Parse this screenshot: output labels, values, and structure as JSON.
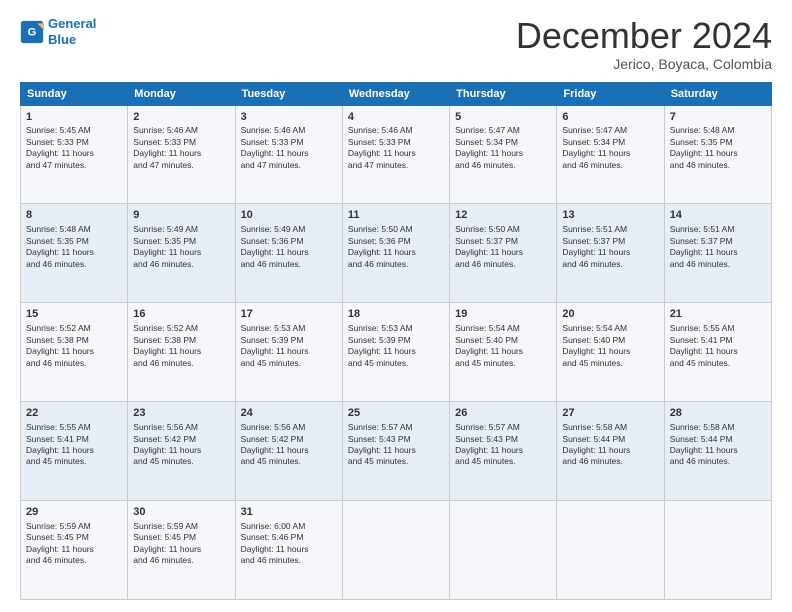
{
  "logo": {
    "line1": "General",
    "line2": "Blue"
  },
  "title": "December 2024",
  "subtitle": "Jerico, Boyaca, Colombia",
  "weekdays": [
    "Sunday",
    "Monday",
    "Tuesday",
    "Wednesday",
    "Thursday",
    "Friday",
    "Saturday"
  ],
  "weeks": [
    [
      {
        "day": 1,
        "lines": [
          "Sunrise: 5:45 AM",
          "Sunset: 5:33 PM",
          "Daylight: 11 hours",
          "and 47 minutes."
        ]
      },
      {
        "day": 2,
        "lines": [
          "Sunrise: 5:46 AM",
          "Sunset: 5:33 PM",
          "Daylight: 11 hours",
          "and 47 minutes."
        ]
      },
      {
        "day": 3,
        "lines": [
          "Sunrise: 5:46 AM",
          "Sunset: 5:33 PM",
          "Daylight: 11 hours",
          "and 47 minutes."
        ]
      },
      {
        "day": 4,
        "lines": [
          "Sunrise: 5:46 AM",
          "Sunset: 5:33 PM",
          "Daylight: 11 hours",
          "and 47 minutes."
        ]
      },
      {
        "day": 5,
        "lines": [
          "Sunrise: 5:47 AM",
          "Sunset: 5:34 PM",
          "Daylight: 11 hours",
          "and 46 minutes."
        ]
      },
      {
        "day": 6,
        "lines": [
          "Sunrise: 5:47 AM",
          "Sunset: 5:34 PM",
          "Daylight: 11 hours",
          "and 46 minutes."
        ]
      },
      {
        "day": 7,
        "lines": [
          "Sunrise: 5:48 AM",
          "Sunset: 5:35 PM",
          "Daylight: 11 hours",
          "and 46 minutes."
        ]
      }
    ],
    [
      {
        "day": 8,
        "lines": [
          "Sunrise: 5:48 AM",
          "Sunset: 5:35 PM",
          "Daylight: 11 hours",
          "and 46 minutes."
        ]
      },
      {
        "day": 9,
        "lines": [
          "Sunrise: 5:49 AM",
          "Sunset: 5:35 PM",
          "Daylight: 11 hours",
          "and 46 minutes."
        ]
      },
      {
        "day": 10,
        "lines": [
          "Sunrise: 5:49 AM",
          "Sunset: 5:36 PM",
          "Daylight: 11 hours",
          "and 46 minutes."
        ]
      },
      {
        "day": 11,
        "lines": [
          "Sunrise: 5:50 AM",
          "Sunset: 5:36 PM",
          "Daylight: 11 hours",
          "and 46 minutes."
        ]
      },
      {
        "day": 12,
        "lines": [
          "Sunrise: 5:50 AM",
          "Sunset: 5:37 PM",
          "Daylight: 11 hours",
          "and 46 minutes."
        ]
      },
      {
        "day": 13,
        "lines": [
          "Sunrise: 5:51 AM",
          "Sunset: 5:37 PM",
          "Daylight: 11 hours",
          "and 46 minutes."
        ]
      },
      {
        "day": 14,
        "lines": [
          "Sunrise: 5:51 AM",
          "Sunset: 5:37 PM",
          "Daylight: 11 hours",
          "and 46 minutes."
        ]
      }
    ],
    [
      {
        "day": 15,
        "lines": [
          "Sunrise: 5:52 AM",
          "Sunset: 5:38 PM",
          "Daylight: 11 hours",
          "and 46 minutes."
        ]
      },
      {
        "day": 16,
        "lines": [
          "Sunrise: 5:52 AM",
          "Sunset: 5:38 PM",
          "Daylight: 11 hours",
          "and 46 minutes."
        ]
      },
      {
        "day": 17,
        "lines": [
          "Sunrise: 5:53 AM",
          "Sunset: 5:39 PM",
          "Daylight: 11 hours",
          "and 45 minutes."
        ]
      },
      {
        "day": 18,
        "lines": [
          "Sunrise: 5:53 AM",
          "Sunset: 5:39 PM",
          "Daylight: 11 hours",
          "and 45 minutes."
        ]
      },
      {
        "day": 19,
        "lines": [
          "Sunrise: 5:54 AM",
          "Sunset: 5:40 PM",
          "Daylight: 11 hours",
          "and 45 minutes."
        ]
      },
      {
        "day": 20,
        "lines": [
          "Sunrise: 5:54 AM",
          "Sunset: 5:40 PM",
          "Daylight: 11 hours",
          "and 45 minutes."
        ]
      },
      {
        "day": 21,
        "lines": [
          "Sunrise: 5:55 AM",
          "Sunset: 5:41 PM",
          "Daylight: 11 hours",
          "and 45 minutes."
        ]
      }
    ],
    [
      {
        "day": 22,
        "lines": [
          "Sunrise: 5:55 AM",
          "Sunset: 5:41 PM",
          "Daylight: 11 hours",
          "and 45 minutes."
        ]
      },
      {
        "day": 23,
        "lines": [
          "Sunrise: 5:56 AM",
          "Sunset: 5:42 PM",
          "Daylight: 11 hours",
          "and 45 minutes."
        ]
      },
      {
        "day": 24,
        "lines": [
          "Sunrise: 5:56 AM",
          "Sunset: 5:42 PM",
          "Daylight: 11 hours",
          "and 45 minutes."
        ]
      },
      {
        "day": 25,
        "lines": [
          "Sunrise: 5:57 AM",
          "Sunset: 5:43 PM",
          "Daylight: 11 hours",
          "and 45 minutes."
        ]
      },
      {
        "day": 26,
        "lines": [
          "Sunrise: 5:57 AM",
          "Sunset: 5:43 PM",
          "Daylight: 11 hours",
          "and 45 minutes."
        ]
      },
      {
        "day": 27,
        "lines": [
          "Sunrise: 5:58 AM",
          "Sunset: 5:44 PM",
          "Daylight: 11 hours",
          "and 46 minutes."
        ]
      },
      {
        "day": 28,
        "lines": [
          "Sunrise: 5:58 AM",
          "Sunset: 5:44 PM",
          "Daylight: 11 hours",
          "and 46 minutes."
        ]
      }
    ],
    [
      {
        "day": 29,
        "lines": [
          "Sunrise: 5:59 AM",
          "Sunset: 5:45 PM",
          "Daylight: 11 hours",
          "and 46 minutes."
        ]
      },
      {
        "day": 30,
        "lines": [
          "Sunrise: 5:59 AM",
          "Sunset: 5:45 PM",
          "Daylight: 11 hours",
          "and 46 minutes."
        ]
      },
      {
        "day": 31,
        "lines": [
          "Sunrise: 6:00 AM",
          "Sunset: 5:46 PM",
          "Daylight: 11 hours",
          "and 46 minutes."
        ]
      },
      null,
      null,
      null,
      null
    ]
  ]
}
